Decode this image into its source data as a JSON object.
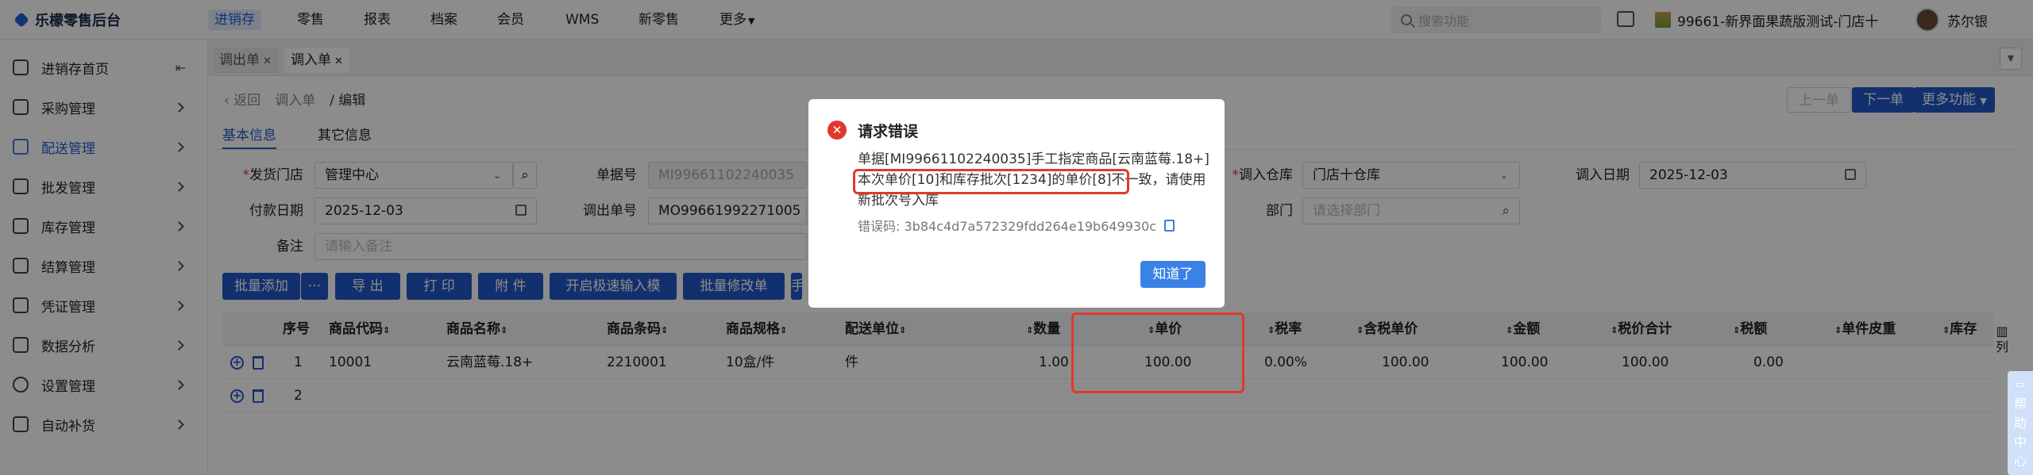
{
  "app": {
    "logo": "乐檬零售后台"
  },
  "nav": {
    "items": [
      "进销存",
      "零售",
      "报表",
      "档案",
      "会员",
      "WMS",
      "新零售",
      "更多"
    ],
    "search_placeholder": "搜索功能",
    "store": "99661-新界面果蔬版测试-门店十",
    "user": "苏尔银"
  },
  "sidebar": {
    "items": [
      {
        "label": "进销存首页",
        "icon": "home-icon"
      },
      {
        "label": "采购管理",
        "icon": "cart-icon"
      },
      {
        "label": "配送管理",
        "icon": "truck-icon"
      },
      {
        "label": "批发管理",
        "icon": "box-icon"
      },
      {
        "label": "库存管理",
        "icon": "inventory-icon"
      },
      {
        "label": "结算管理",
        "icon": "money-icon"
      },
      {
        "label": "凭证管理",
        "icon": "document-icon"
      },
      {
        "label": "数据分析",
        "icon": "chart-icon"
      },
      {
        "label": "设置管理",
        "icon": "settings-icon"
      },
      {
        "label": "自动补货",
        "icon": "refill-icon"
      }
    ]
  },
  "tabs": [
    {
      "label": "调出单"
    },
    {
      "label": "调入单"
    }
  ],
  "page": {
    "back": "返回",
    "breadcrumb_parent": "调入单",
    "breadcrumb_current": "编辑",
    "subtabs": [
      "基本信息",
      "其它信息"
    ],
    "prev_btn": "上一单",
    "next_btn": "下一单",
    "more_btn": "更多功能"
  },
  "form": {
    "send_store_label": "发货门店",
    "send_store_value": "管理中心",
    "doc_no_label": "单据号",
    "doc_no_value": "MI99661102240035",
    "in_warehouse_label": "调入仓库",
    "in_warehouse_value": "门店十仓库",
    "in_date_label": "调入日期",
    "in_date_value": "2025-12-03",
    "pay_date_label": "付款日期",
    "pay_date_value": "2025-12-03",
    "out_no_label": "调出单号",
    "out_no_value": "MO99661992271005",
    "dept_label": "部门",
    "dept_placeholder": "请选择部门",
    "remark_label": "备注",
    "remark_placeholder": "请输入备注"
  },
  "toolbar": {
    "batch_add": "批量添加",
    "more": "···",
    "export": "导 出",
    "print": "打 印",
    "attach": "附 件",
    "fast_input": "开启极速输入模式",
    "batch_edit": "批量修改单据",
    "cut": "手"
  },
  "table": {
    "headers": [
      "序号",
      "商品代码",
      "商品名称",
      "商品条码",
      "商品规格",
      "配送单位",
      "数量",
      "单价",
      "税率",
      "含税单价",
      "金额",
      "税价合计",
      "税额",
      "单件皮重",
      "库存"
    ],
    "rows": [
      [
        "1",
        "10001",
        "云南蓝莓.18+",
        "2210001",
        "10盒/件",
        "件",
        "1.00",
        "100.00",
        "0.00%",
        "100.00",
        "100.00",
        "100.00",
        "0.00",
        "",
        ""
      ],
      [
        "2",
        "",
        "",
        "",
        "",
        "",
        "",
        "",
        "",
        "",
        "",
        "",
        "",
        "",
        ""
      ]
    ],
    "col_toggle": "列"
  },
  "modal": {
    "title": "请求错误",
    "message": "单据[MI99661102240035]手工指定商品[云南蓝莓.18+]本次单价[10]和库存批次[1234]的单价[8]不一致，请使用新批次号入库",
    "error_code": "错误码: 3b84c4d7a572329fdd264e19b649930c",
    "ok": "知道了"
  },
  "help": "帮助中心",
  "colors": {
    "primary": "#2358c8",
    "error": "#e0392c",
    "active_nav_bg": "#e3ebfb"
  }
}
